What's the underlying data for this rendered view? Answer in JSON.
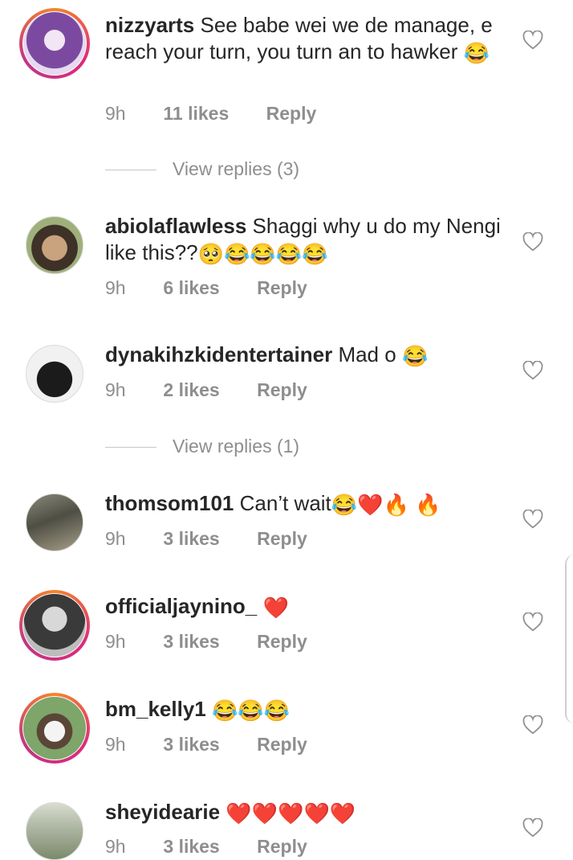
{
  "comments": [
    {
      "username": "nizzyarts",
      "text": "See babe wei we de manage, e reach your turn, you turn an to hawker",
      "emojis": "😂",
      "time": "9h",
      "likes": "11 likes",
      "reply": "Reply",
      "avatar_bg": "#b58bd6",
      "story_ring": true
    },
    {
      "username": "abiolaflawless",
      "text": "Shaggi why u do my Nengi like this??",
      "emojis": "🥺😂😂😂😂",
      "time": "9h",
      "likes": "6 likes",
      "reply": "Reply",
      "avatar_bg": "#7a6a58",
      "story_ring": false
    },
    {
      "username": "dynakihzkidentertainer",
      "text": "Mad o",
      "emojis": "😂",
      "time": "9h",
      "likes": "2 likes",
      "reply": "Reply",
      "avatar_bg": "#2a2a2a",
      "story_ring": false
    },
    {
      "username": "thomsom101",
      "text": "Can’t wait",
      "emojis": "😂❤️🔥 🔥",
      "time": "9h",
      "likes": "3 likes",
      "reply": "Reply",
      "avatar_bg": "#6b6b5a",
      "story_ring": false
    },
    {
      "username": "officialjaynino_",
      "text": "",
      "emojis": "❤️",
      "time": "9h",
      "likes": "3 likes",
      "reply": "Reply",
      "avatar_bg": "#5a5a5a",
      "story_ring": true
    },
    {
      "username": "bm_kelly1",
      "text": "",
      "emojis": "😂😂😂",
      "time": "9h",
      "likes": "3 likes",
      "reply": "Reply",
      "avatar_bg": "#6b8f5a",
      "story_ring": true
    },
    {
      "username": "sheyidearie",
      "text": "",
      "emojis": "❤️❤️❤️❤️❤️",
      "time": "9h",
      "likes": "3 likes",
      "reply": "Reply",
      "avatar_bg": "#a8b4a0",
      "story_ring": false
    }
  ],
  "view_replies": [
    {
      "label": "View replies (3)"
    },
    {
      "label": "View replies (1)"
    }
  ],
  "icons": {
    "like": "heart-outline-icon"
  }
}
